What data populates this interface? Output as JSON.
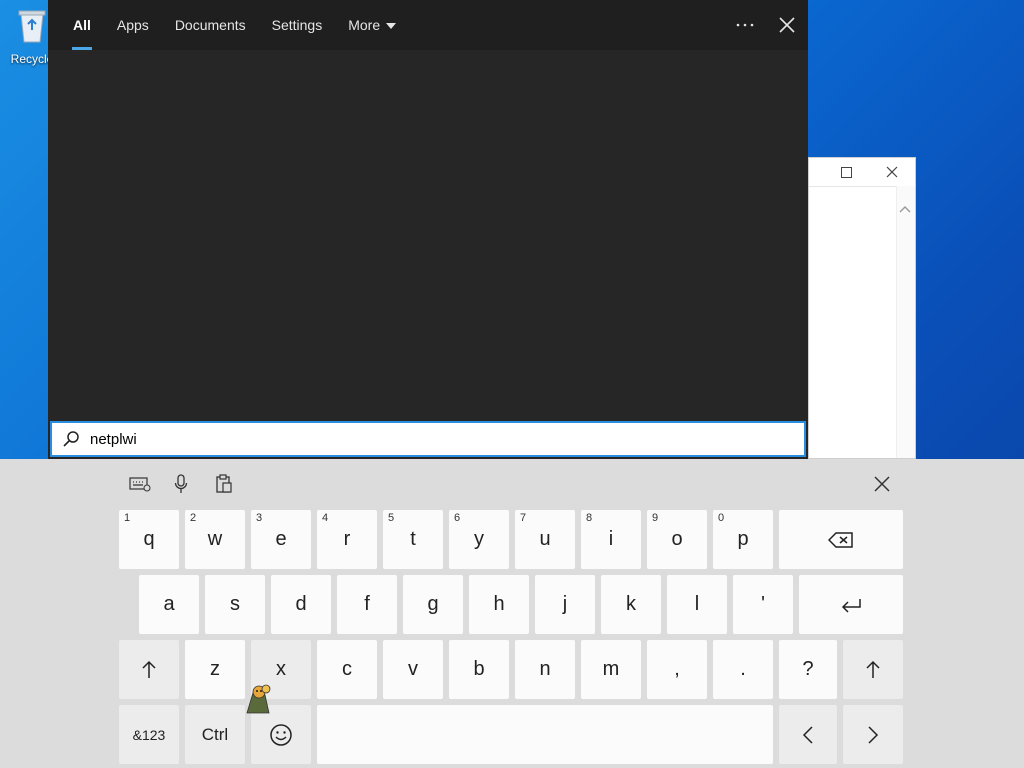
{
  "desktop": {
    "recycle_label": "Recycle"
  },
  "search": {
    "tabs": [
      {
        "label": "All"
      },
      {
        "label": "Apps"
      },
      {
        "label": "Documents"
      },
      {
        "label": "Settings"
      },
      {
        "label": "More"
      }
    ],
    "query": "netplwi",
    "more_icon": "ellipsis-icon",
    "close_icon": "close-icon"
  },
  "keyboard": {
    "row1": [
      {
        "num": "1",
        "key": "q"
      },
      {
        "num": "2",
        "key": "w"
      },
      {
        "num": "3",
        "key": "e"
      },
      {
        "num": "4",
        "key": "r"
      },
      {
        "num": "5",
        "key": "t"
      },
      {
        "num": "6",
        "key": "y"
      },
      {
        "num": "7",
        "key": "u"
      },
      {
        "num": "8",
        "key": "i"
      },
      {
        "num": "9",
        "key": "o"
      },
      {
        "num": "0",
        "key": "p"
      }
    ],
    "row2": [
      "a",
      "s",
      "d",
      "f",
      "g",
      "h",
      "j",
      "k",
      "l",
      "'"
    ],
    "row3": [
      "z",
      "x",
      "c",
      "v",
      "b",
      "n",
      "m",
      ",",
      ".",
      "?"
    ],
    "symbols_label": "&123",
    "ctrl_label": "Ctrl"
  },
  "colors": {
    "accent": "#2a8ee0",
    "panel": "#262626",
    "keyboard_bg": "#dcdcdc"
  }
}
